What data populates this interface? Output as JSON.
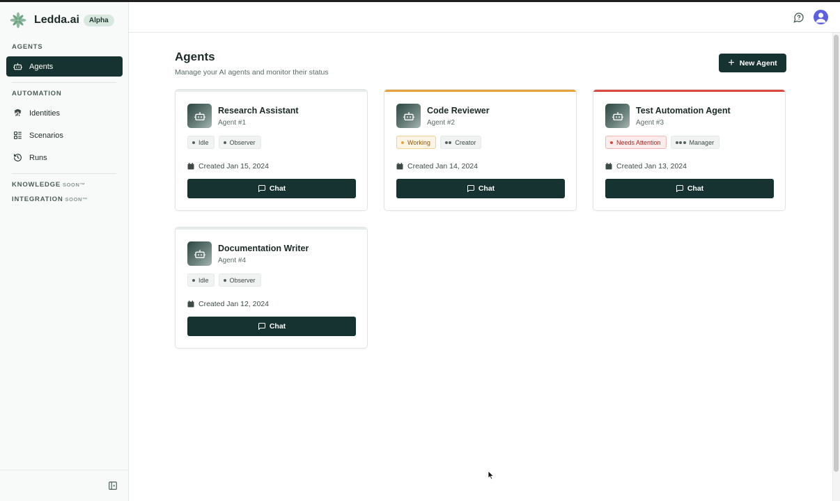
{
  "brand": {
    "name": "Ledda.ai",
    "badge": "Alpha"
  },
  "sidebar": {
    "sections": [
      {
        "label": "AGENTS"
      },
      {
        "label": "AUTOMATION"
      },
      {
        "label": "KNOWLEDGE",
        "soon": "SOON™"
      },
      {
        "label": "INTEGRATION",
        "soon": "SOON™"
      }
    ],
    "items": [
      {
        "label": "Agents",
        "icon": "robot-icon",
        "active": true
      },
      {
        "label": "Identities",
        "icon": "fingerprint-icon"
      },
      {
        "label": "Scenarios",
        "icon": "layout-list-icon"
      },
      {
        "label": "Runs",
        "icon": "history-icon"
      }
    ]
  },
  "main": {
    "title": "Agents",
    "subtitle": "Manage your AI agents and monitor their status",
    "new_agent_label": "New Agent"
  },
  "agents": [
    {
      "name": "Research Assistant",
      "id": "Agent #1",
      "status": "Idle",
      "role": "Observer",
      "created": "Created Jan 15, 2024",
      "chat_label": "Chat",
      "accent": "#e8ecea"
    },
    {
      "name": "Code Reviewer",
      "id": "Agent #2",
      "status": "Working",
      "role": "Creator",
      "created": "Created Jan 14, 2024",
      "chat_label": "Chat",
      "accent": "#e9a23b"
    },
    {
      "name": "Test Automation Agent",
      "id": "Agent #3",
      "status": "Needs Attention",
      "role": "Manager",
      "created": "Created Jan 13, 2024",
      "chat_label": "Chat",
      "accent": "#d9473f"
    },
    {
      "name": "Documentation Writer",
      "id": "Agent #4",
      "status": "Idle",
      "role": "Observer",
      "created": "Created Jan 12, 2024",
      "chat_label": "Chat",
      "accent": "#e8ecea"
    }
  ],
  "colors": {
    "primary": "#163331",
    "working": "#e9a23b",
    "attention": "#d9473f",
    "avatar": "#5b5fe0"
  }
}
